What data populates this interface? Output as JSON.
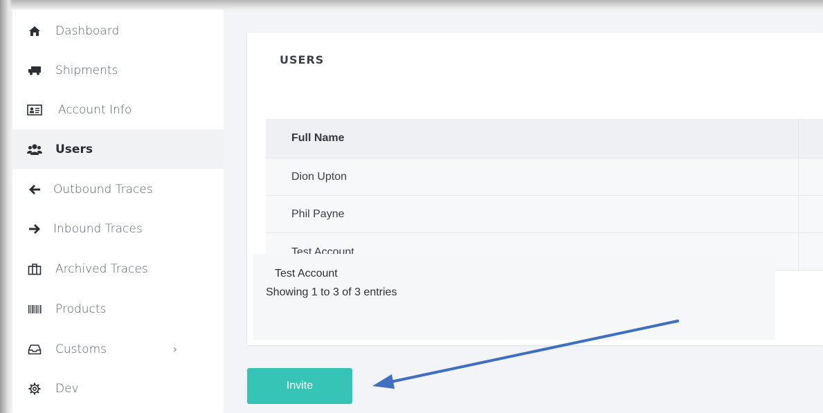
{
  "sidebar": {
    "items": [
      {
        "label": "Dashboard",
        "icon": "home-icon"
      },
      {
        "label": "Shipments",
        "icon": "truck-icon"
      },
      {
        "label": "Account Info",
        "icon": "id-card-icon"
      },
      {
        "label": "Users",
        "icon": "users-icon",
        "active": true
      },
      {
        "label": "Outbound Traces",
        "icon": "arrow-left-icon"
      },
      {
        "label": "Inbound Traces",
        "icon": "arrow-right-icon"
      },
      {
        "label": "Archived Traces",
        "icon": "archive-icon"
      },
      {
        "label": "Products",
        "icon": "barcode-icon"
      },
      {
        "label": "Customs",
        "icon": "inbox-icon",
        "chevron": "›"
      },
      {
        "label": "Dev",
        "icon": "gear-icon"
      }
    ]
  },
  "main": {
    "title": "USERS",
    "table": {
      "header": "Full Name",
      "rows": [
        "Dion Upton",
        "Phil Payne",
        "Test Account"
      ]
    },
    "overlay_label": "Test Account",
    "showing": "Showing 1 to 3 of 3 entries",
    "invite_label": "Invite"
  },
  "colors": {
    "invite_button": "#35c4b5",
    "annotation_arrow": "#3e6fc1",
    "active_nav_bg": "#f1f2f4"
  }
}
